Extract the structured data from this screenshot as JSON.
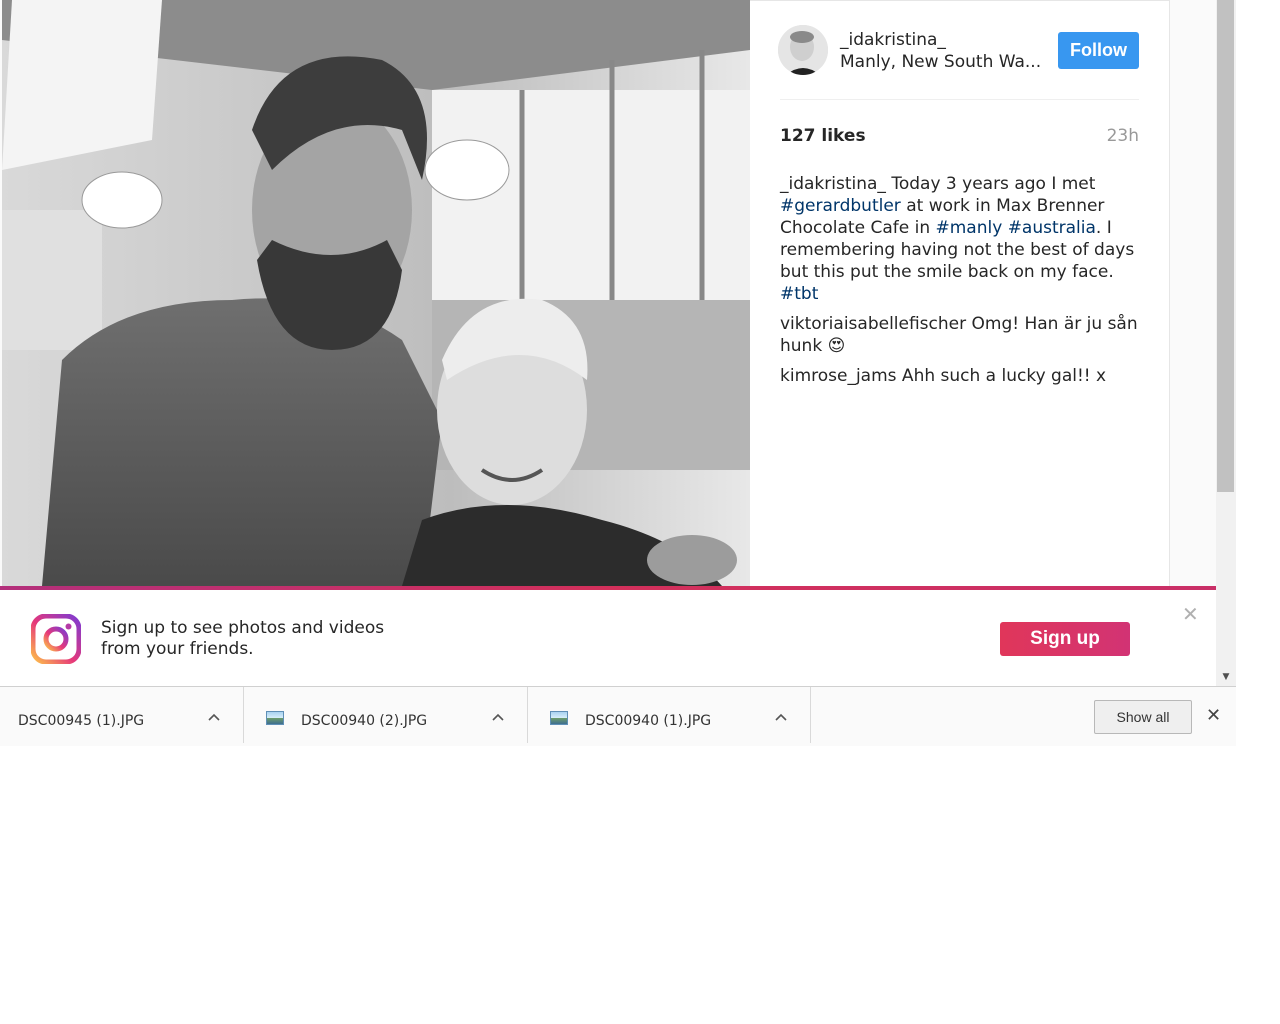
{
  "post": {
    "username": "_idakristina_",
    "location": "Manly, New South Wa...",
    "follow_label": "Follow",
    "likes": "127 likes",
    "time": "23h",
    "caption": {
      "user": "_idakristina_",
      "text1": " Today 3 years ago I met ",
      "tag1": "#gerardbutler",
      "text2": " at work in Max Brenner Chocolate Cafe in ",
      "tag2": "#manly",
      "text3": " ",
      "tag3": "#australia",
      "text4": ". I remembering having not the best of days but this put the smile back on my face. ",
      "tag4": "#tbt"
    },
    "comments": [
      {
        "user": "viktoriaisabellefischer",
        "text": " Omg! Han är ju sån hunk 😍"
      },
      {
        "user": "kimrose_jams",
        "text": " Ahh such a lucky gal!! x"
      }
    ]
  },
  "banner": {
    "text": "Sign up to see photos and videos from your friends.",
    "signup_label": "Sign up",
    "close_glyph": "✕"
  },
  "downloads": {
    "items": [
      {
        "name": "DSC00945 (1).JPG",
        "has_icon": false
      },
      {
        "name": "DSC00940 (2).JPG",
        "has_icon": true
      },
      {
        "name": "DSC00940 (1).JPG",
        "has_icon": true
      }
    ],
    "show_all_label": "Show all",
    "close_glyph": "✕",
    "caret_glyph": "^"
  },
  "icons": {
    "scroll_down": "▼",
    "file": "image-file-icon"
  },
  "colors": {
    "follow": "#3897f0",
    "hashtag": "#003569",
    "signup": "#e0365a"
  }
}
